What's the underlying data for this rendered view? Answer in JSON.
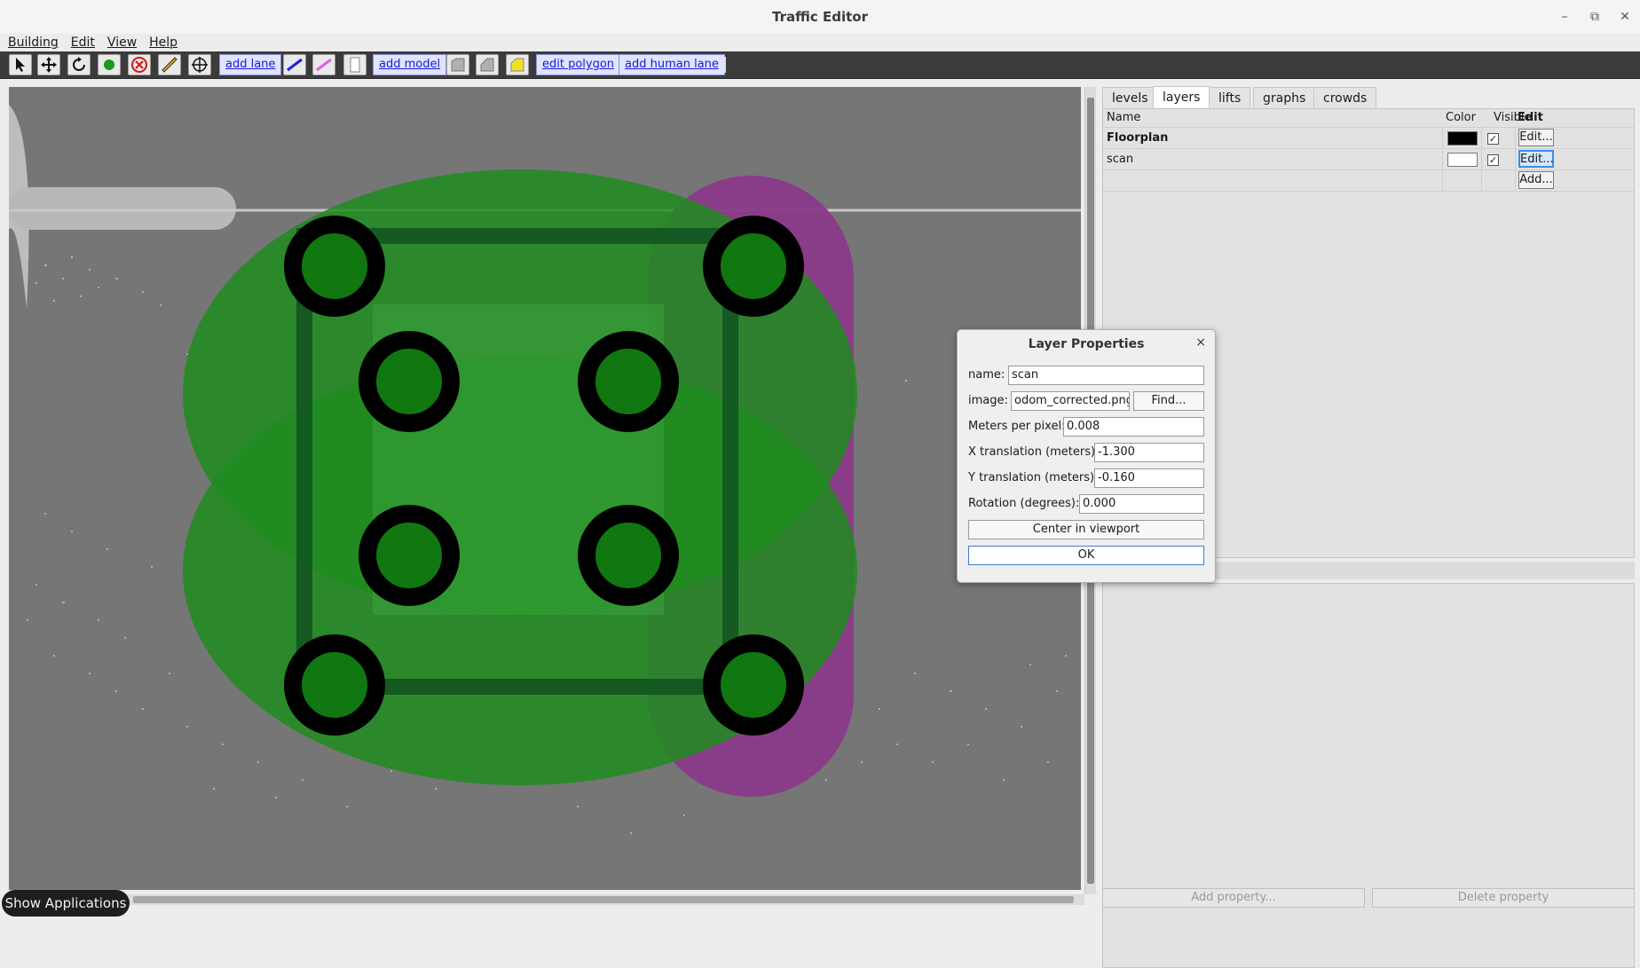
{
  "window": {
    "title": "Traffic Editor",
    "controls": [
      "–",
      "⧉",
      "✕"
    ]
  },
  "menu": [
    "Building",
    "Edit",
    "View",
    "Help"
  ],
  "toolbar": {
    "icons": [
      "select-arrow-icon",
      "move-icon",
      "rotate-icon",
      "add-vertex-icon",
      "delete-icon",
      "measure-icon",
      "fiducial-icon"
    ],
    "add_lane": "add lane",
    "add_model": "add model",
    "edit_polygon": "edit polygon",
    "add_human_lane": "add human lane"
  },
  "tabs": [
    "levels",
    "layers",
    "lifts",
    "graphs",
    "crowds"
  ],
  "active_tab": "layers",
  "layers_table": {
    "headers": {
      "name": "Name",
      "color": "Color",
      "visible": "Visible",
      "edit": "Edit"
    },
    "rows": [
      {
        "name": "Floorplan",
        "color": "#000000",
        "visible": "✓",
        "edit": "Edit..."
      },
      {
        "name": "scan",
        "color": "#ffffff",
        "visible": "✓",
        "edit": "Edit..."
      }
    ],
    "add": "Add..."
  },
  "properties": {
    "add": "Add property...",
    "delete": "Delete property"
  },
  "dialog": {
    "title": "Layer Properties",
    "close": "×",
    "name_label": "name:",
    "name_value": "scan",
    "image_label": "image:",
    "image_value": "odom_corrected.png",
    "find": "Find...",
    "mpp_label": "Meters per pixel:",
    "mpp_value": "0.008",
    "x_label": "X translation (meters):",
    "x_value": "-1.300",
    "y_label": "Y translation (meters):",
    "y_value": "-0.160",
    "rot_label": "Rotation (degrees):",
    "rot_value": "0.000",
    "center": "Center in viewport",
    "ok": "OK"
  },
  "taskbar": {
    "show_apps": "Show Applications"
  },
  "colors": {
    "green_zone": "#1e8a1e",
    "purple_zone": "#8a3a8a",
    "canvas_bg": "#767676",
    "toolbar_bg": "#3b3b3b"
  }
}
